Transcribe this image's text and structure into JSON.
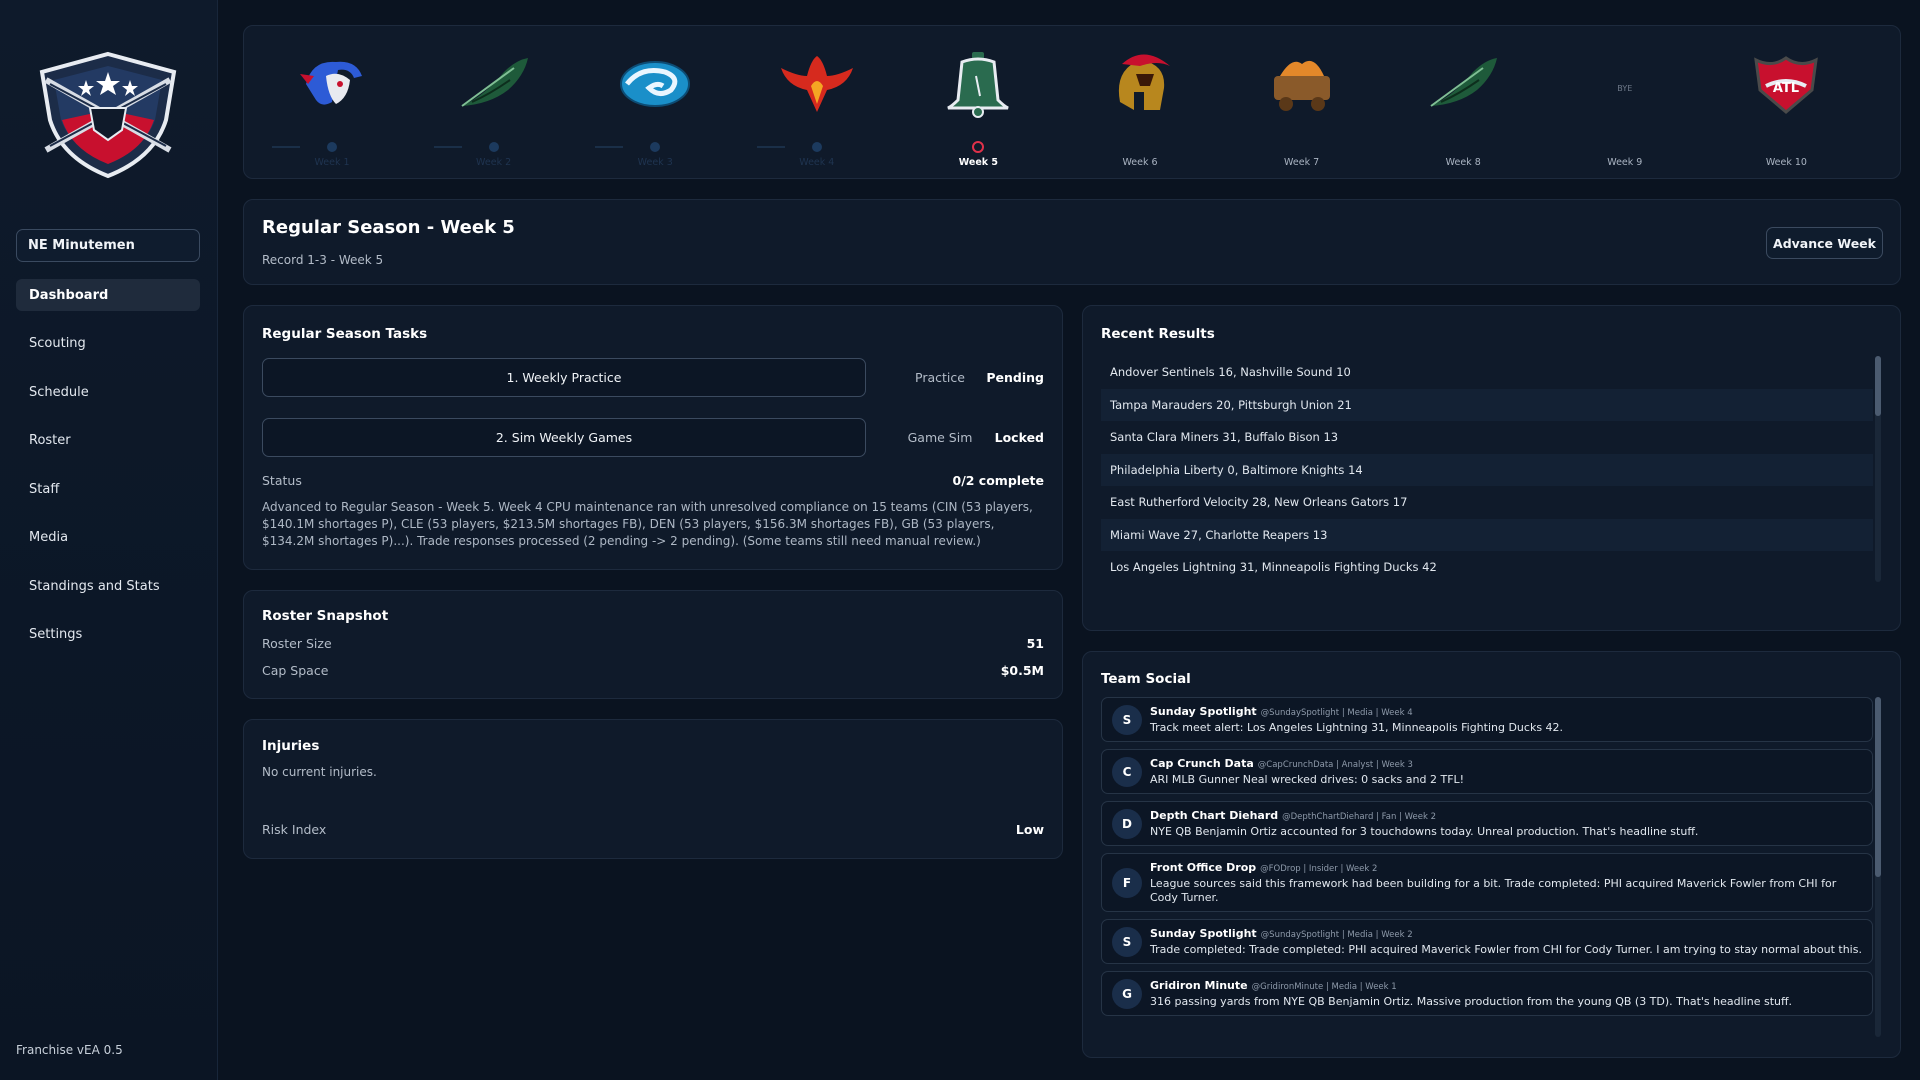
{
  "sidebar": {
    "team_name": "NE Minutemen",
    "nav": [
      "Dashboard",
      "Scouting",
      "Schedule",
      "Roster",
      "Staff",
      "Media",
      "Standings and Stats",
      "Settings"
    ],
    "active": "Dashboard",
    "version": "Franchise vEA 0.5"
  },
  "weeks": [
    {
      "label": "Week 1",
      "logo": "bison-icon",
      "state": "past"
    },
    {
      "label": "Week 2",
      "logo": "green-feather-icon",
      "state": "past"
    },
    {
      "label": "Week 3",
      "logo": "wave-icon",
      "state": "past"
    },
    {
      "label": "Week 4",
      "logo": "phoenix-icon",
      "state": "past"
    },
    {
      "label": "Week 5",
      "logo": "liberty-bell-icon",
      "state": "current"
    },
    {
      "label": "Week 6",
      "logo": "spartan-helmet-icon",
      "state": "future"
    },
    {
      "label": "Week 7",
      "logo": "miner-cart-icon",
      "state": "future"
    },
    {
      "label": "Week 8",
      "logo": "green-feather-icon",
      "state": "future"
    },
    {
      "label": "Week 9",
      "logo": "",
      "bye": "BYE",
      "state": "future"
    },
    {
      "label": "Week 10",
      "logo": "atl-shield-icon",
      "state": "future"
    }
  ],
  "header": {
    "title": "Regular Season - Week 5",
    "subtitle": "Record 1-3 - Week 5",
    "advance_label": "Advance Week"
  },
  "tasks": {
    "title": "Regular Season Tasks",
    "items": [
      {
        "label": "1. Weekly Practice",
        "kind": "Practice",
        "state": "Pending"
      },
      {
        "label": "2. Sim Weekly Games",
        "kind": "Game Sim",
        "state": "Locked"
      }
    ],
    "status_label": "Status",
    "status_value": "0/2 complete",
    "status_text": "Advanced to Regular Season - Week 5. Week 4 CPU maintenance ran with unresolved compliance on 15 teams (CIN (53 players, $140.1M shortages P), CLE (53 players, $213.5M shortages FB), DEN (53 players, $156.3M shortages FB), GB (53 players, $134.2M shortages P)...). Trade responses processed (2 pending -> 2 pending). (Some teams still need manual review.)"
  },
  "roster": {
    "title": "Roster Snapshot",
    "size_label": "Roster Size",
    "size_value": "51",
    "cap_label": "Cap Space",
    "cap_value": "$0.5M"
  },
  "injuries": {
    "title": "Injuries",
    "text": "No current injuries.",
    "risk_label": "Risk Index",
    "risk_value": "Low"
  },
  "results": {
    "title": "Recent Results",
    "items": [
      "Andover Sentinels 16, Nashville Sound 10",
      "Tampa Marauders 20, Pittsburgh Union 21",
      "Santa Clara Miners 31, Buffalo Bison 13",
      "Philadelphia Liberty 0, Baltimore Knights 14",
      "East Rutherford Velocity 28, New Orleans Gators 17",
      "Miami Wave 27, Charlotte Reapers 13",
      "Los Angeles Lightning 31, Minneapolis Fighting Ducks 42"
    ]
  },
  "social": {
    "title": "Team Social",
    "posts": [
      {
        "initial": "S",
        "author": "Sunday Spotlight",
        "meta": "@SundaySpotlight | Media | Week 4",
        "text": "Track meet alert: Los Angeles Lightning 31, Minneapolis Fighting Ducks 42."
      },
      {
        "initial": "C",
        "author": "Cap Crunch Data",
        "meta": "@CapCrunchData | Analyst | Week 3",
        "text": "ARI MLB Gunner Neal wrecked drives: 0 sacks and 2 TFL!"
      },
      {
        "initial": "D",
        "author": "Depth Chart Diehard",
        "meta": "@DepthChartDiehard | Fan | Week 2",
        "text": "NYE QB Benjamin Ortiz accounted for 3 touchdowns today. Unreal production. That's headline stuff."
      },
      {
        "initial": "F",
        "author": "Front Office Drop",
        "meta": "@FODrop | Insider | Week 2",
        "text": "League sources said this framework had been building for a bit. Trade completed: PHI acquired Maverick Fowler from CHI for Cody Turner."
      },
      {
        "initial": "S",
        "author": "Sunday Spotlight",
        "meta": "@SundaySpotlight | Media | Week 2",
        "text": "Trade completed: Trade completed: PHI acquired Maverick Fowler from CHI for Cody Turner. I am trying to stay normal about this."
      },
      {
        "initial": "G",
        "author": "Gridiron Minute",
        "meta": "@GridironMinute | Media | Week 1",
        "text": "316 passing yards from NYE QB Benjamin Ortiz. Massive production from the young QB (3 TD). That's headline stuff."
      }
    ]
  },
  "colors": {
    "background": "#0a1320",
    "panel": "#0f1a2a",
    "accent_red": "#e0314a",
    "dot_blue": "#1c3a5e"
  }
}
